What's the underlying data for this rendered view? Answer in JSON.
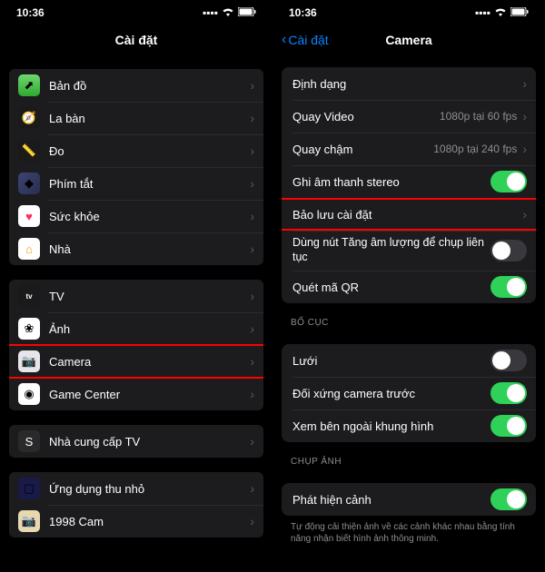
{
  "left": {
    "time": "10:36",
    "title": "Cài đặt",
    "groups": [
      {
        "items": [
          {
            "icon": "maps-icon",
            "iconClass": "ic-maps",
            "glyph": "⬈",
            "label": "Bản đồ"
          },
          {
            "icon": "compass-icon",
            "iconClass": "ic-compass",
            "glyph": "🧭",
            "label": "La bàn"
          },
          {
            "icon": "measure-icon",
            "iconClass": "ic-measure",
            "glyph": "📏",
            "label": "Đo"
          },
          {
            "icon": "shortcuts-icon",
            "iconClass": "ic-shortcuts",
            "glyph": "◆",
            "label": "Phím tắt"
          },
          {
            "icon": "health-icon",
            "iconClass": "ic-health",
            "glyph": "♥",
            "label": "Sức khỏe"
          },
          {
            "icon": "home-icon",
            "iconClass": "ic-home",
            "glyph": "⌂",
            "label": "Nhà"
          }
        ]
      },
      {
        "items": [
          {
            "icon": "tv-icon",
            "iconClass": "ic-tv",
            "glyph": "tv",
            "label": "TV"
          },
          {
            "icon": "photos-icon",
            "iconClass": "ic-photos",
            "glyph": "❀",
            "label": "Ảnh"
          },
          {
            "icon": "camera-icon",
            "iconClass": "ic-camera",
            "glyph": "📷",
            "label": "Camera",
            "highlight": true
          },
          {
            "icon": "gamecenter-icon",
            "iconClass": "ic-gc",
            "glyph": "◉",
            "label": "Game Center"
          }
        ]
      },
      {
        "items": [
          {
            "icon": "tvprovider-icon",
            "iconClass": "ic-tvprov",
            "glyph": "S",
            "label": "Nhà cung cấp TV"
          }
        ]
      },
      {
        "items": [
          {
            "icon": "miniapp-icon",
            "iconClass": "ic-mini",
            "glyph": "▢",
            "label": "Ứng dụng thu nhỏ"
          },
          {
            "icon": "1998cam-icon",
            "iconClass": "ic-1998",
            "glyph": "📷",
            "label": "1998 Cam"
          }
        ]
      }
    ]
  },
  "right": {
    "time": "10:36",
    "back": "Cài đặt",
    "title": "Camera",
    "groups": [
      {
        "items": [
          {
            "label": "Định dạng",
            "type": "link"
          },
          {
            "label": "Quay Video",
            "value": "1080p tại 60 fps",
            "type": "link"
          },
          {
            "label": "Quay chậm",
            "value": "1080p tại 240 fps",
            "type": "link"
          },
          {
            "label": "Ghi âm thanh stereo",
            "type": "toggle",
            "on": true
          },
          {
            "label": "Bảo lưu cài đặt",
            "type": "link",
            "highlight": true
          },
          {
            "label": "Dùng nút Tăng âm lượng để chụp liên tục",
            "type": "toggle",
            "on": false,
            "tall": true
          },
          {
            "label": "Quét mã QR",
            "type": "toggle",
            "on": true
          }
        ]
      },
      {
        "header": "BỐ CỤC",
        "items": [
          {
            "label": "Lưới",
            "type": "toggle",
            "on": false
          },
          {
            "label": "Đối xứng camera trước",
            "type": "toggle",
            "on": true
          },
          {
            "label": "Xem bên ngoài khung hình",
            "type": "toggle",
            "on": true
          }
        ]
      },
      {
        "header": "CHỤP ẢNH",
        "items": [
          {
            "label": "Phát hiện cảnh",
            "type": "toggle",
            "on": true
          }
        ],
        "footer": "Tự động cải thiện ảnh về các cảnh khác nhau bằng tính năng nhận biết hình ảnh thông minh."
      }
    ]
  }
}
